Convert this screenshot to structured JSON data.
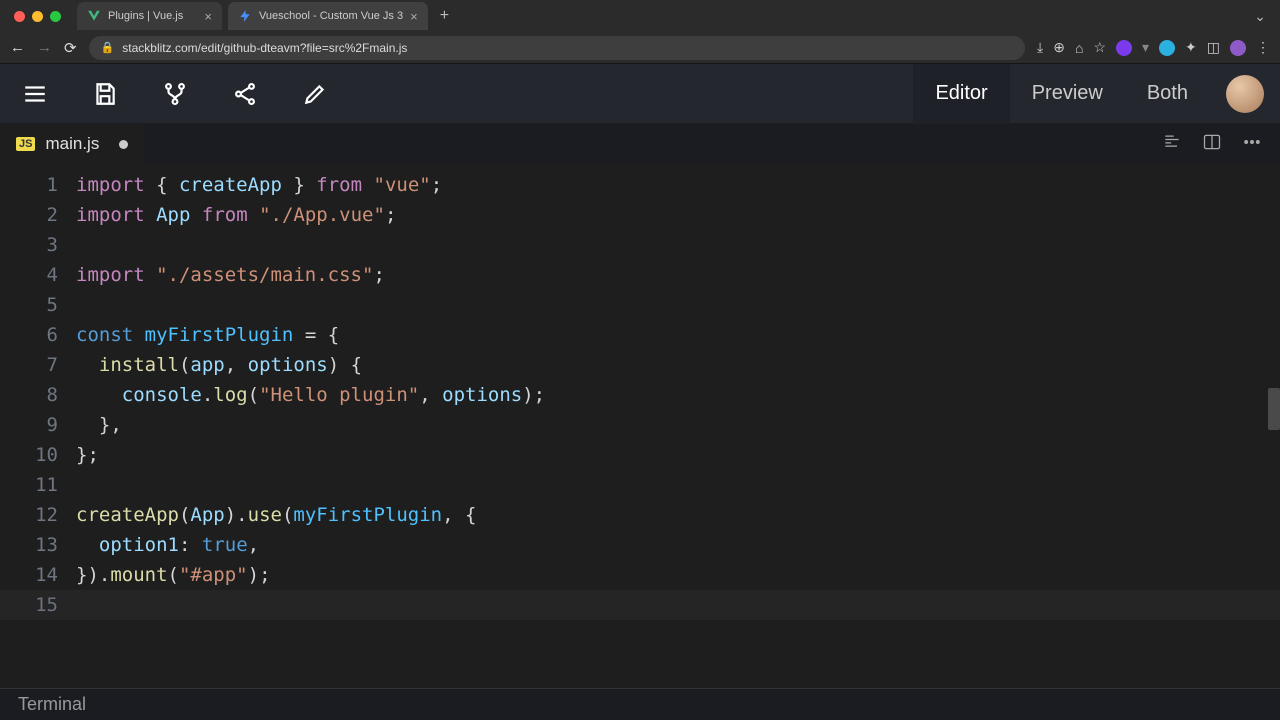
{
  "browser": {
    "tabs": [
      {
        "title": "Plugins | Vue.js",
        "favicon": "vue"
      },
      {
        "title": "Vueschool - Custom Vue Js 3",
        "favicon": "bolt",
        "active": true
      }
    ],
    "url": "stackblitz.com/edit/github-dteavm?file=src%2Fmain.js"
  },
  "toolbar": {
    "views": {
      "editor": "Editor",
      "preview": "Preview",
      "both": "Both"
    }
  },
  "file_tab": {
    "badge": "JS",
    "name": "main.js",
    "dirty": true
  },
  "code": {
    "lines": 15
  },
  "terminal": {
    "label": "Terminal"
  }
}
